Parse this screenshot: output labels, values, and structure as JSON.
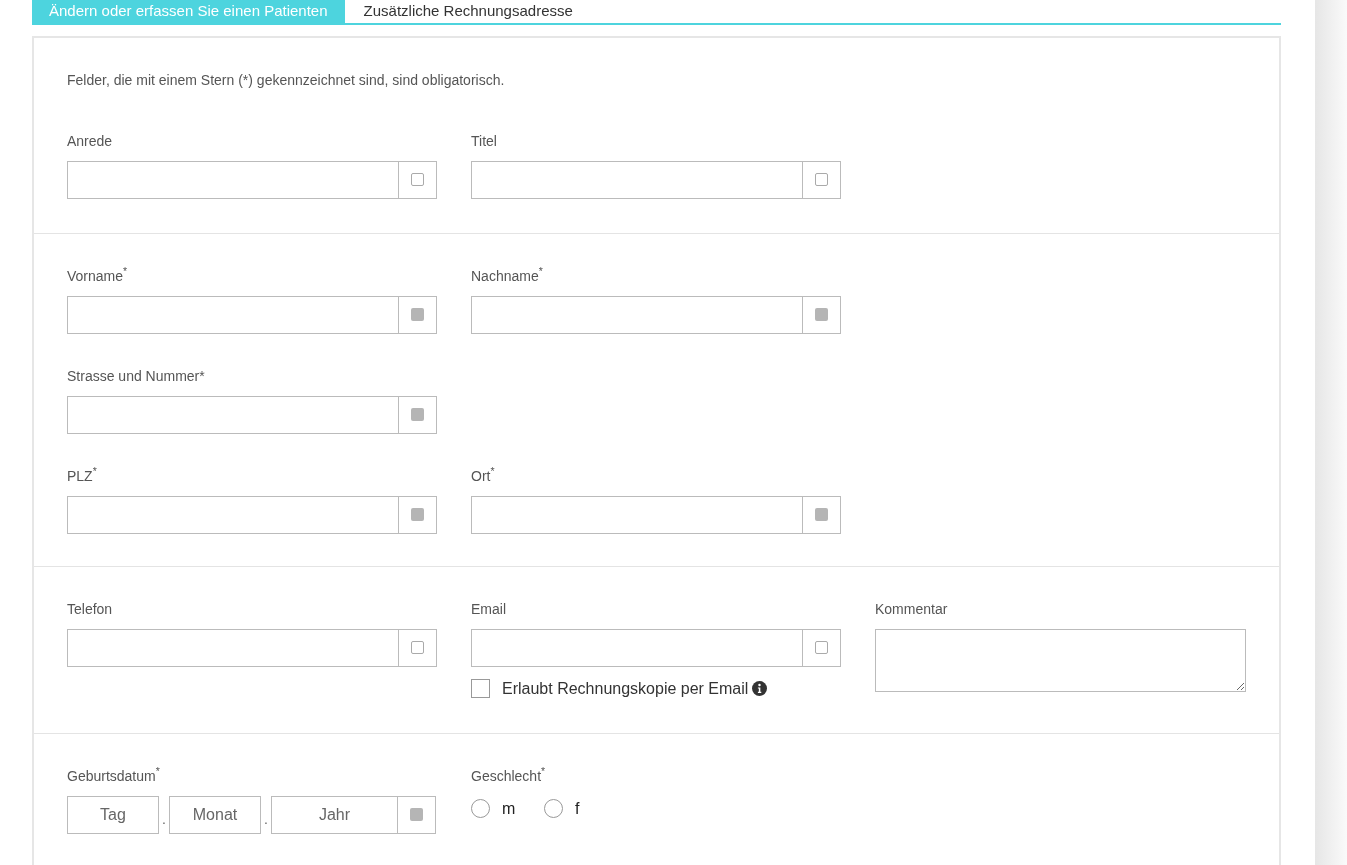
{
  "tabs": [
    {
      "label": "Ändern oder erfassen Sie einen Patienten",
      "selected": true
    },
    {
      "label": "Zusätzliche Rechnungsadresse",
      "selected": false
    }
  ],
  "note": "Felder, die mit einem Stern (*) gekennzeichnet sind, sind obligatorisch.",
  "sections": [
    {
      "rows": [
        [
          {
            "kind": "text",
            "label": "Anrede",
            "required": false
          },
          {
            "kind": "text",
            "label": "Titel",
            "required": false
          }
        ]
      ]
    },
    {
      "rows": [
        [
          {
            "kind": "text",
            "label": "Vorname$^{*}$",
            "required": true
          },
          {
            "kind": "text",
            "label": "Nachname$^{*}$",
            "required": true
          }
        ],
        [
          {
            "kind": "text",
            "label": "Strasse und Nummer*",
            "required": true
          }
        ],
        [
          {
            "kind": "text",
            "label": "PLZ$^{*}$",
            "required": true
          },
          {
            "kind": "text",
            "label": "Ort$^{*}$",
            "required": true
          }
        ]
      ]
    },
    {
      "rows": [
        [
          {
            "kind": "text",
            "label": "Telefon",
            "required": false
          },
          {
            "kind": "text",
            "label": "Email",
            "required": false,
            "option": {
              "label": "Erlaubt Rechnungskopie per Email",
              "checked": false
            }
          },
          {
            "kind": "textarea",
            "label": "Kommentar"
          }
        ]
      ]
    },
    {
      "rows": [
        [
          {
            "kind": "date",
            "label": "Geburtsdatum$^{*}$",
            "required": true,
            "parts": [
              {
                "placeholder": "Tag",
                "separator": "."
              },
              {
                "placeholder": "Monat",
                "separator": "."
              },
              {
                "placeholder": "Jahr"
              }
            ]
          },
          {
            "kind": "radio",
            "label": "Geschlecht$^{*}$",
            "options": [
              {
                "label": "m",
                "selected": false
              },
              {
                "label": "f",
                "selected": false
              }
            ]
          }
        ]
      ]
    }
  ]
}
